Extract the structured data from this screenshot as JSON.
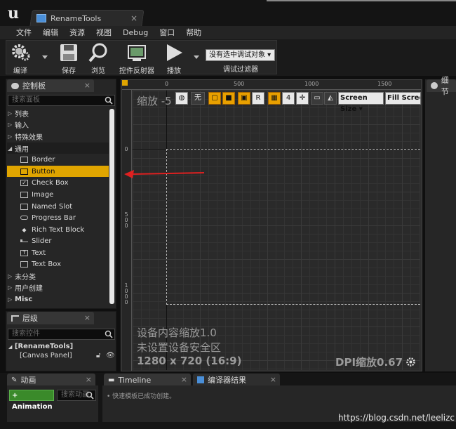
{
  "window": {
    "doc_tab": "RenameTools"
  },
  "menu": [
    "文件",
    "编辑",
    "资源",
    "视图",
    "Debug",
    "窗口",
    "帮助"
  ],
  "toolbar": {
    "compile": "编译",
    "save": "保存",
    "browse": "浏览",
    "reflector": "控件反射器",
    "play": "播放",
    "debug_select": "没有选中调试对象",
    "debug_filter": "调试过滤器"
  },
  "palette": {
    "tab": "控制板",
    "search_placeholder": "搜索面板",
    "categories_top": [
      "列表",
      "输入",
      "特殊效果"
    ],
    "category_open": "通用",
    "items": [
      "Border",
      "Button",
      "Check Box",
      "Image",
      "Named Slot",
      "Progress Bar",
      "Rich Text Block",
      "Slider",
      "Text",
      "Text Box"
    ],
    "selected_item": "Button",
    "categories_bottom": [
      "未分类",
      "用户创建",
      "Misc"
    ]
  },
  "hierarchy": {
    "tab": "层级",
    "search_placeholder": "搜索控件",
    "root": "[RenameTools]",
    "child": "[Canvas Panel]"
  },
  "designer": {
    "zoom": "缩放 -5",
    "ruler_top": [
      "0",
      "500",
      "1000",
      "1500"
    ],
    "ruler_left": [
      "0",
      "500",
      "1000"
    ],
    "btn_none": "无",
    "btn_r": "R",
    "btn_grid_num": "4",
    "screen_size": "Screen Size",
    "fill_screen": "Fill Screen",
    "info_scale": "设备内容缩放1.0",
    "info_safe": "未设置设备安全区",
    "info_res": "1280 x 720 (16:9)",
    "dpi": "DPI缩放0.67"
  },
  "details": {
    "tab": "细节"
  },
  "bottom": {
    "anim_tab": "动画",
    "anim_button": "+ Animation",
    "anim_search": "搜索动画",
    "timeline_tab": "Timeline",
    "compiler_tab": "编译器结果",
    "log_line": "•   快速模板已成功创建。"
  },
  "watermark": "https://blog.csdn.net/leelizc",
  "colors": {
    "selection": "#e0a500",
    "arrow": "#e02020",
    "accent_orange": "#e8a000"
  }
}
